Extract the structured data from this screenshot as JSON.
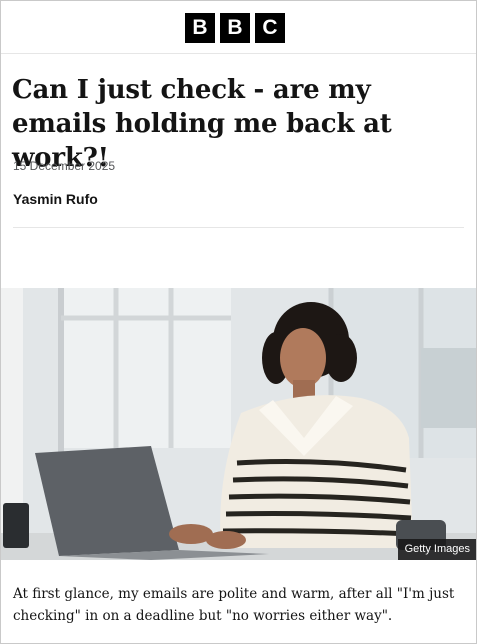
{
  "header": {
    "logo_letters": [
      "B",
      "B",
      "C"
    ]
  },
  "article": {
    "headline": "Can I just check - are my emails holding me back at work?!",
    "date": "15 December 2025",
    "author": "Yasmin Rufo",
    "image": {
      "credit": "Getty Images"
    },
    "paragraph": "At first glance, my emails are polite and warm, after all \"I'm just checking\" in on a deadline but \"no worries either way\"."
  }
}
